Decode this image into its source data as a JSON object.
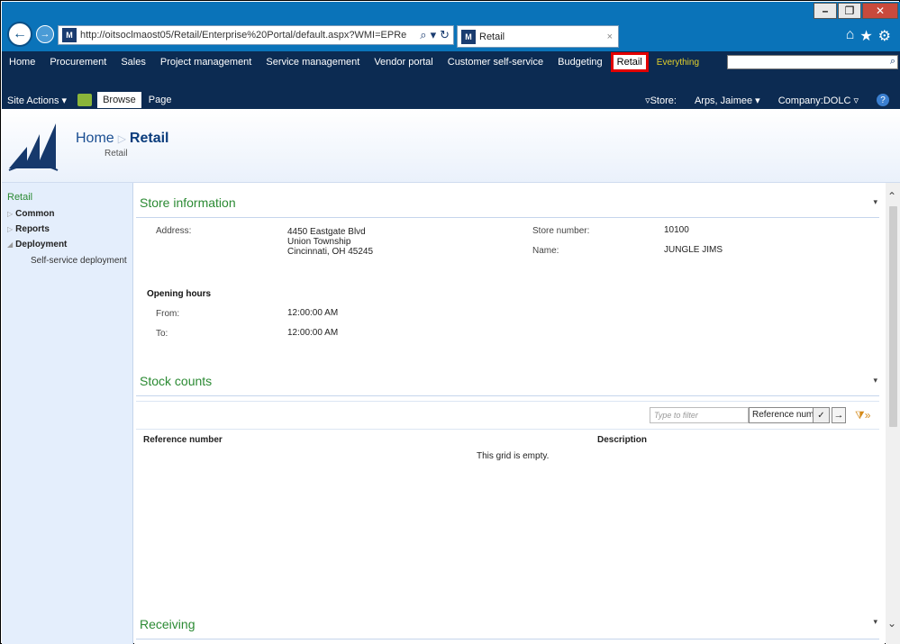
{
  "browser": {
    "url": "http://oitsoclmaost05/Retail/Enterprise%20Portal/default.aspx?WMI=EPRe",
    "tab_title": "Retail",
    "favicon_label": "M"
  },
  "top_nav": {
    "items": [
      "Home",
      "Procurement",
      "Sales",
      "Project management",
      "Service management",
      "Vendor portal",
      "Customer self-service",
      "Budgeting"
    ],
    "active": "Retail",
    "search_scope": "Everything"
  },
  "ribbon": {
    "site_actions": "Site Actions ▾",
    "browse": "Browse",
    "page": "Page",
    "store": "▿Store:",
    "user": "Arps, Jaimee ▾",
    "company": "Company:DOLC ▿"
  },
  "header": {
    "home": "Home",
    "current": "Retail",
    "subtitle": "Retail"
  },
  "sidebar": {
    "root": "Retail",
    "nodes": [
      {
        "label": "Common",
        "arrow": "▷"
      },
      {
        "label": "Reports",
        "arrow": "▷"
      },
      {
        "label": "Deployment",
        "arrow": "◢"
      }
    ],
    "child": "Self-service deployment"
  },
  "store_info": {
    "title": "Store information",
    "address_label": "Address:",
    "address_line1": "4450 Eastgate Blvd",
    "address_line2": "Union Township",
    "address_line3": "Cincinnati, OH 45245",
    "store_number_label": "Store number:",
    "store_number": "10100",
    "name_label": "Name:",
    "name": "JUNGLE JIMS",
    "hours_title": "Opening hours",
    "from_label": "From:",
    "from": "12:00:00 AM",
    "to_label": "To:",
    "to": "12:00:00 AM"
  },
  "stock_counts": {
    "title": "Stock counts",
    "filter_placeholder": "Type to filter",
    "filter_field": "Reference num",
    "col_reference": "Reference number",
    "col_description": "Description",
    "empty": "This grid is empty."
  },
  "receiving": {
    "title": "Receiving"
  }
}
